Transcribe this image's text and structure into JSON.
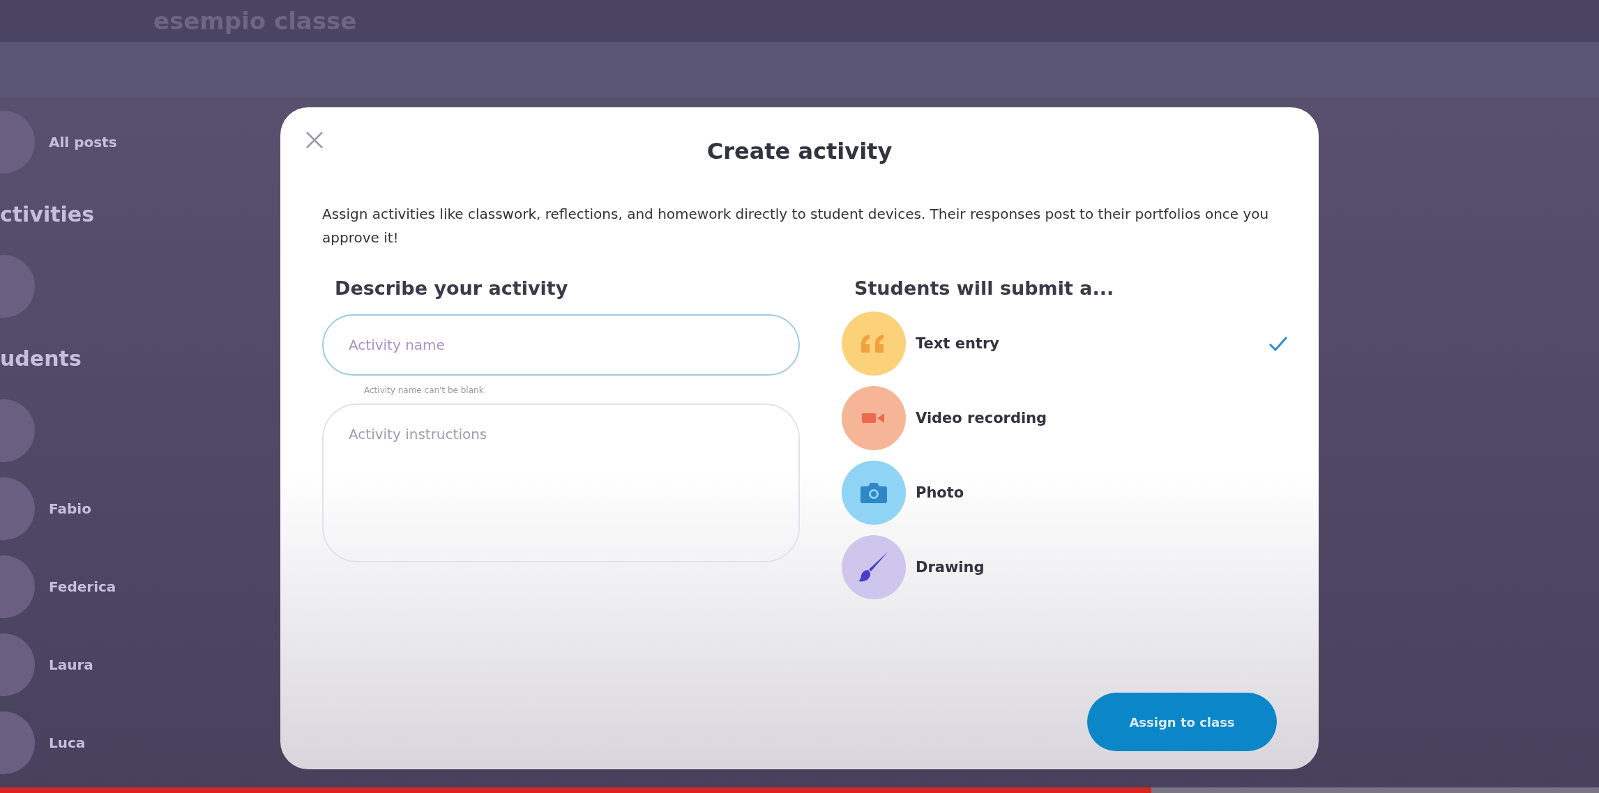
{
  "header": {
    "title": "esempio classe"
  },
  "sidebar": {
    "items": [
      {
        "kind": "item",
        "label": "All posts"
      },
      {
        "kind": "heading",
        "label": "ctivities"
      },
      {
        "kind": "item"
      },
      {
        "kind": "heading",
        "label": "udents"
      },
      {
        "kind": "item"
      },
      {
        "kind": "item",
        "label": "Fabio"
      },
      {
        "kind": "item",
        "label": "Federica"
      },
      {
        "kind": "item",
        "label": "Laura"
      },
      {
        "kind": "item",
        "label": "Luca"
      }
    ]
  },
  "dialog": {
    "title": "Create activity",
    "intro": "Assign activities like classwork, reflections, and homework directly to student devices. Their responses post to their portfolios once you approve it!",
    "describe": {
      "heading": "Describe your activity",
      "name_field": {
        "placeholder": "Activity name"
      },
      "error": "Activity name can't be blank",
      "instructions_field": {
        "placeholder": "Activity instructions"
      }
    },
    "submit": {
      "heading": "Students will submit a...",
      "options": [
        {
          "kind": "quote",
          "label": "Text entry",
          "color": "#fbd27a",
          "selected": true
        },
        {
          "kind": "video",
          "label": "Video recording",
          "color": "#f7b597",
          "selected": false
        },
        {
          "kind": "camera",
          "label": "Photo",
          "color": "#8fd3f5",
          "selected": false
        },
        {
          "kind": "brush",
          "label": "Drawing",
          "color": "#cfc6ee",
          "selected": false
        }
      ]
    },
    "button": "Assign to class"
  },
  "video_progress": {
    "level": 0.72
  }
}
